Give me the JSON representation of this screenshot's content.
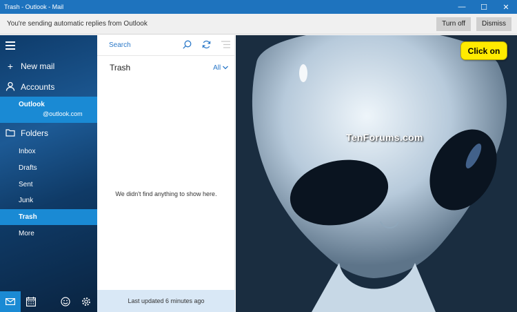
{
  "window": {
    "title": "Trash - Outlook - Mail",
    "buttons": {
      "minimize": "—",
      "maximize": "☐",
      "close": "✕"
    }
  },
  "infobar": {
    "message": "You're sending automatic replies from Outlook",
    "turn_off_label": "Turn off",
    "dismiss_label": "Dismiss"
  },
  "sidebar": {
    "new_mail_label": "New mail",
    "accounts_label": "Accounts",
    "account": {
      "name": "Outlook",
      "email": "@outlook.com"
    },
    "folders_label": "Folders",
    "folders": [
      {
        "label": "Inbox",
        "active": false
      },
      {
        "label": "Drafts",
        "active": false
      },
      {
        "label": "Sent",
        "active": false
      },
      {
        "label": "Junk",
        "active": false
      },
      {
        "label": "Trash",
        "active": true
      },
      {
        "label": "More",
        "active": false
      }
    ],
    "bottom_icons": [
      "mail-icon",
      "calendar-icon",
      "feedback-icon",
      "settings-icon"
    ]
  },
  "message_list": {
    "search_placeholder": "Search",
    "folder_title": "Trash",
    "filter_label": "All",
    "empty_text": "We didn't find anything to show here.",
    "last_updated": "Last updated 6 minutes ago"
  },
  "reading_pane": {
    "watermark": "TenForums.com"
  },
  "annotation": {
    "callout_text": "Click on"
  },
  "colors": {
    "accent": "#1e73be",
    "highlight": "#1a8ad4",
    "callout": "#ffeb00"
  }
}
